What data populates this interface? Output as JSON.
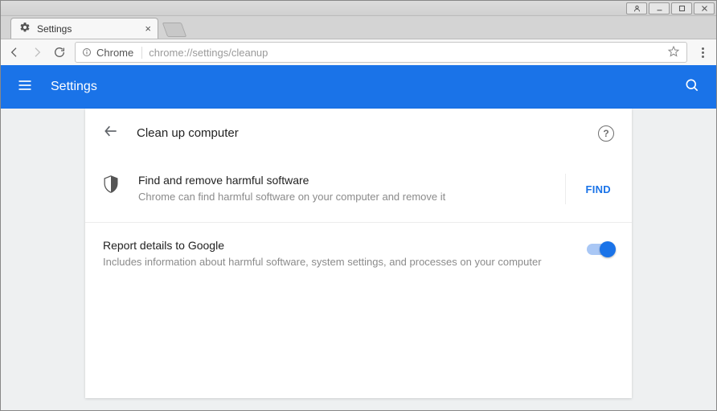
{
  "os": {
    "user_btn": "user",
    "min": "minimize",
    "max": "maximize",
    "close": "close"
  },
  "tab": {
    "title": "Settings"
  },
  "omnibox": {
    "scheme_label": "Chrome",
    "url": "chrome://settings/cleanup"
  },
  "header": {
    "title": "Settings"
  },
  "card": {
    "title": "Clean up computer",
    "find": {
      "title": "Find and remove harmful software",
      "subtitle": "Chrome can find harmful software on your computer and remove it",
      "button": "FIND"
    },
    "report": {
      "title": "Report details to Google",
      "subtitle": "Includes information about harmful software, system settings, and processes on your computer",
      "enabled": true
    }
  }
}
